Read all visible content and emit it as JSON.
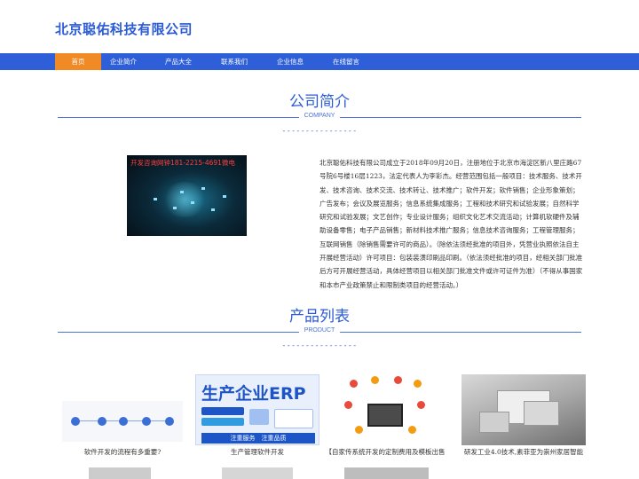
{
  "header": {
    "company_name": "北京聪佑科技有限公司"
  },
  "nav": {
    "items": [
      {
        "label": "首页",
        "active": true
      },
      {
        "label": "企业简介",
        "active": false
      },
      {
        "label": "产品大全",
        "active": false
      },
      {
        "label": "联系我们",
        "active": false
      },
      {
        "label": "企业信息",
        "active": false
      },
      {
        "label": "在线留言",
        "active": false
      }
    ]
  },
  "colors": {
    "brand_blue": "#2e5fd8",
    "active_orange": "#f08a24"
  },
  "about": {
    "title": "公司简介",
    "subtitle": "COMPANY",
    "dashes": "----------------",
    "image_caption": "开发咨询网钟181-2215-4691微电",
    "paragraph": "北京聪佑科技有限公司成立于2018年09月20日，注册地位于北京市海淀区新八里庄路67号院6号楼16层1223，法定代表人为李彩杰。经营范围包括一般项目：技术服务、技术开发、技术咨询、技术交流、技术转让、技术推广；软件开发；软件销售；企业形象策划；广告发布；会议及展览服务；信息系统集成服务；工程和技术研究和试验发展；自然科学研究和试验发展；文艺创作；专业设计服务；组织文化艺术交流活动；计算机软硬件及辅助设备零售；电子产品销售；新材料技术推广服务；信息技术咨询服务；工程管理服务；互联网销售（除销售需要许可的商品）。（除依法须经批准的项目外，凭营业执照依法自主开展经营活动）许可项目：包装装潢印刷品印刷。（依法须经批准的项目，经相关部门批准后方可开展经营活动，具体经营项目以相关部门批准文件或许可证件为准）（不得从事国家和本市产业政策禁止和限制类项目的经营活动。）"
  },
  "products": {
    "title": "产品列表",
    "subtitle": "PRODUCT",
    "dashes": "----------------",
    "items": [
      {
        "caption": "软件开发的流程有多重要?",
        "icon": "workflow-diagram-image"
      },
      {
        "caption": "生产管理软件开发",
        "icon": "erp-banner-image",
        "image_text": "生产企业ERP",
        "image_footer": "注重服务　注重品质"
      },
      {
        "caption": "【自家传系统开发的定制费用及模板出售",
        "icon": "system-network-image"
      },
      {
        "caption": "研发工业4.0技术,素菲亚为崇州家居智能",
        "icon": "room-render-image"
      }
    ]
  }
}
